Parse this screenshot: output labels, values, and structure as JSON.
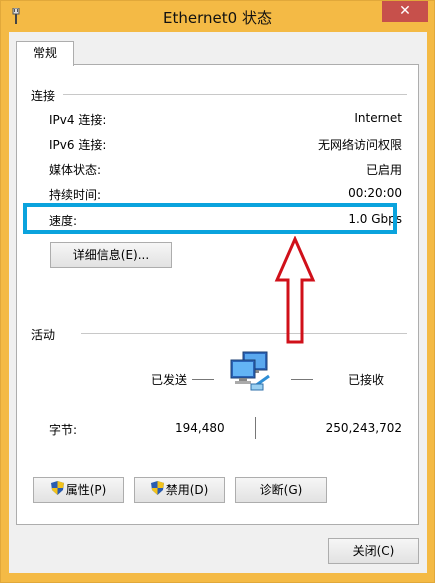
{
  "window": {
    "title": "Ethernet0 状态",
    "close_glyph": "✕"
  },
  "tab": {
    "label": "常规"
  },
  "connection": {
    "section_title": "连接",
    "rows": [
      {
        "label": "IPv4 连接:",
        "value": "Internet"
      },
      {
        "label": "IPv6 连接:",
        "value": "无网络访问权限"
      },
      {
        "label": "媒体状态:",
        "value": "已启用"
      },
      {
        "label": "持续时间:",
        "value": "00:20:00"
      },
      {
        "label": "速度:",
        "value": "1.0 Gbps"
      }
    ],
    "details_button": "详细信息(E)..."
  },
  "activity": {
    "section_title": "活动",
    "sent_label": "已发送",
    "received_label": "已接收",
    "bytes_label": "字节:",
    "bytes_sent": "194,480",
    "bytes_received": "250,243,702"
  },
  "buttons": {
    "properties": "属性(P)",
    "disable": "禁用(D)",
    "diagnose": "诊断(G)",
    "close": "关闭(C)"
  },
  "icons": {
    "window_icon": "ethernet-plug-icon",
    "network_icon": "network-computers-icon",
    "shield_icon": "uac-shield-icon"
  },
  "colors": {
    "title_bar": "#f4ba45",
    "highlight_box": "#0aa3dd",
    "annotation_arrow": "#d0101a",
    "close_button": "#c7504b"
  }
}
